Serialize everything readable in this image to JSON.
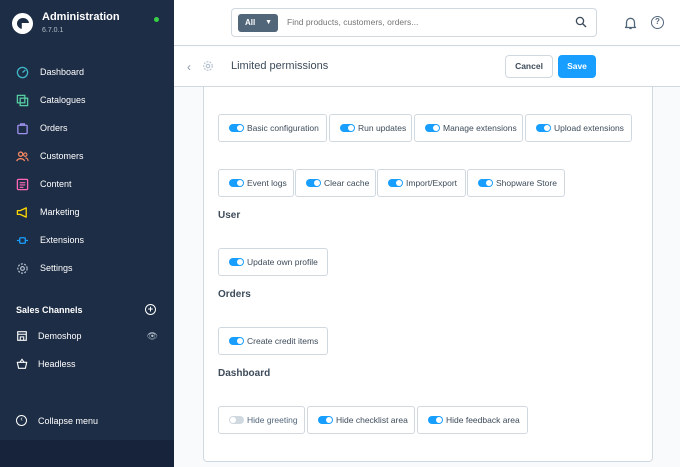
{
  "sidebar": {
    "title": "Administration",
    "version": "6.7.0.1",
    "items": [
      {
        "label": "Dashboard",
        "icon": "gauge-icon"
      },
      {
        "label": "Catalogues",
        "icon": "products-icon"
      },
      {
        "label": "Orders",
        "icon": "shopping-bag-icon"
      },
      {
        "label": "Customers",
        "icon": "users-icon"
      },
      {
        "label": "Content",
        "icon": "content-icon"
      },
      {
        "label": "Marketing",
        "icon": "megaphone-icon"
      },
      {
        "label": "Extensions",
        "icon": "plug-icon"
      },
      {
        "label": "Settings",
        "icon": "gear-icon"
      }
    ],
    "sales_channels_label": "Sales Channels",
    "sales_channels": [
      {
        "label": "Demoshop",
        "icon": "storefront-icon"
      },
      {
        "label": "Headless",
        "icon": "basket-icon"
      }
    ],
    "collapse_label": "Collapse menu",
    "accent": "#189eff",
    "background": "#1d2d45"
  },
  "topbar": {
    "search_type": "All",
    "search_placeholder": "Find products, customers, orders..."
  },
  "smartbar": {
    "title": "Limited permissions",
    "cancel_label": "Cancel",
    "save_label": "Save"
  },
  "permissions": {
    "group1": [
      {
        "label": "Basic configuration",
        "on": true
      },
      {
        "label": "Run updates",
        "on": true
      },
      {
        "label": "Manage extensions",
        "on": true
      },
      {
        "label": "Upload extensions",
        "on": true
      }
    ],
    "group2": [
      {
        "label": "Event logs",
        "on": true
      },
      {
        "label": "Clear cache",
        "on": true
      },
      {
        "label": "Import/Export",
        "on": true
      },
      {
        "label": "Shopware Store",
        "on": true
      }
    ],
    "user_title": "User",
    "user": [
      {
        "label": "Update own profile",
        "on": true
      }
    ],
    "orders_title": "Orders",
    "orders": [
      {
        "label": "Create credit items",
        "on": true
      }
    ],
    "dashboard_title": "Dashboard",
    "dashboard": [
      {
        "label": "Hide greeting",
        "on": false
      },
      {
        "label": "Hide checklist area",
        "on": true
      },
      {
        "label": "Hide feedback area",
        "on": true
      }
    ]
  }
}
